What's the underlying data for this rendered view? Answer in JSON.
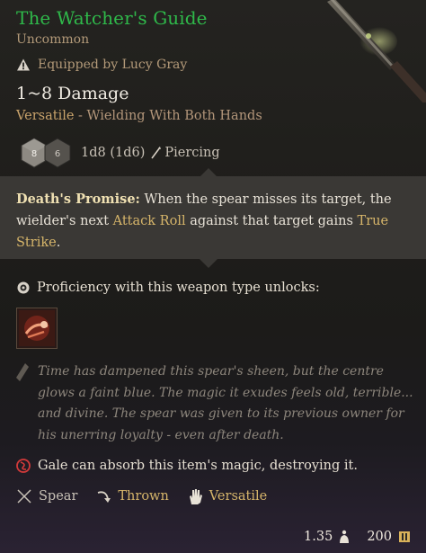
{
  "item": {
    "name": "The Watcher's Guide",
    "rarity": "Uncommon",
    "equipped_text": "Equipped by Lucy Gray",
    "damage": "1~8 Damage",
    "versatile_label": "Versatile",
    "versatile_desc": " - Wielding With Both Hands",
    "dice_text": "1d8 (1d6)",
    "dice_faces": [
      "8",
      "6"
    ],
    "damage_type": "Piercing"
  },
  "passive": {
    "name": "Death's Promise:",
    "text_1": " When the spear misses its target, the wielder's next ",
    "hl_1": "Attack Roll",
    "text_2": " against that target gains ",
    "hl_2": "True Strike",
    "text_3": "."
  },
  "proficiency": {
    "label": "Proficiency with this weapon type unlocks:"
  },
  "lore": "Time has dampened this spear's sheen, but the centre glows a faint blue. The magic it exudes feels old, terrible... and divine. The spear was given to its previous owner for his unerring loyalty - even after death.",
  "gale_text": "Gale can absorb this item's magic, destroying it.",
  "traits": [
    {
      "label": "Spear",
      "icon": "crossed-spears-icon"
    },
    {
      "label": "Thrown",
      "icon": "throw-arrow-icon"
    },
    {
      "label": "Versatile",
      "icon": "hand-icon"
    }
  ],
  "footer": {
    "weight": "1.35",
    "price": "200"
  },
  "colors": {
    "uncommon_green": "#2fb84a",
    "accent_gold": "#d6b56a",
    "passive_bg": "#3a3835"
  }
}
